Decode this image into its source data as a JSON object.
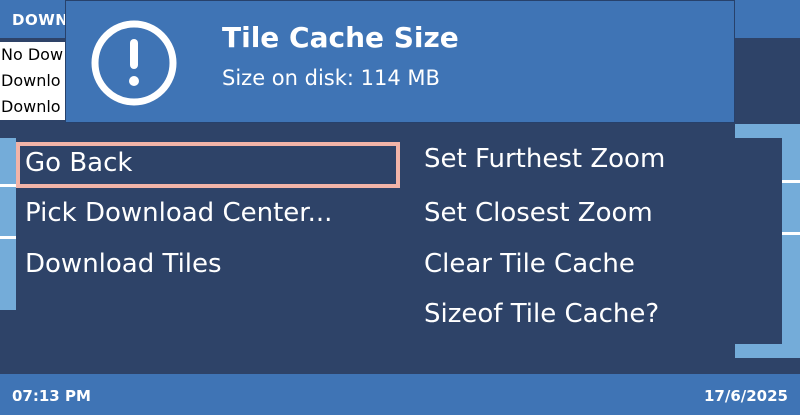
{
  "background": {
    "header_title": "DOWN",
    "lines": [
      "No Dow",
      "Downlo",
      "Downlo"
    ]
  },
  "dialog": {
    "icon": "exclamation-circle-icon",
    "title": "Tile Cache Size",
    "message": "Size on disk: 114 MB"
  },
  "menu": {
    "items": [
      {
        "label": "Go Back",
        "selected": true
      },
      {
        "label": "Pick Download Center..."
      },
      {
        "label": "Download Tiles"
      },
      {
        "label": "Set Furthest Zoom"
      },
      {
        "label": "Set Closest Zoom"
      },
      {
        "label": "Clear Tile Cache"
      },
      {
        "label": "Sizeof Tile Cache?"
      }
    ]
  },
  "statusbar": {
    "time": "07:13 PM",
    "date": "17/6/2025"
  },
  "colors": {
    "background": "#2e4368",
    "accent_blue": "#3f74b5",
    "light_blue": "#74acd9",
    "selection_border": "#f2b4a8"
  }
}
